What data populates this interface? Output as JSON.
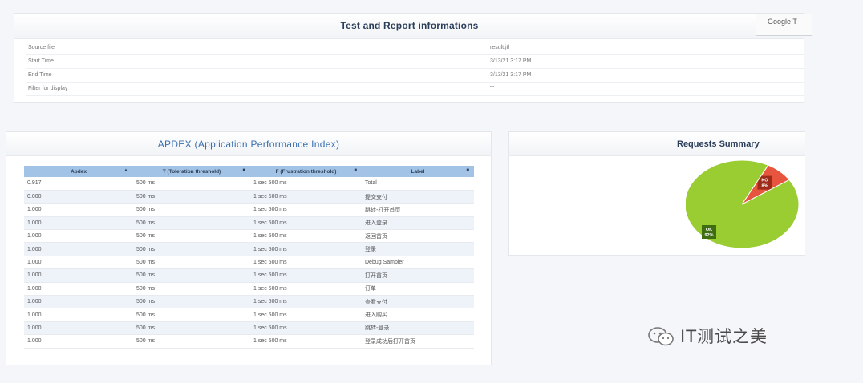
{
  "info": {
    "title": "Test and Report informations",
    "google_button": "Google T",
    "rows": [
      {
        "key": "Source file",
        "value": "result.jtl"
      },
      {
        "key": "Start Time",
        "value": "3/13/21 3:17 PM"
      },
      {
        "key": "End Time",
        "value": "3/13/21 3:17 PM"
      },
      {
        "key": "Filter for display",
        "value": "\"\""
      }
    ]
  },
  "apdex": {
    "title": "APDEX (Application Performance Index)",
    "headers": [
      "Apdex",
      "T (Toleration threshold)",
      "F (Frustration threshold)",
      "Label"
    ],
    "rows": [
      [
        "0.917",
        "500 ms",
        "1 sec 500 ms",
        "Total"
      ],
      [
        "0.000",
        "500 ms",
        "1 sec 500 ms",
        "提交支付"
      ],
      [
        "1.000",
        "500 ms",
        "1 sec 500 ms",
        "跳转-打开首页"
      ],
      [
        "1.000",
        "500 ms",
        "1 sec 500 ms",
        "进入登录"
      ],
      [
        "1.000",
        "500 ms",
        "1 sec 500 ms",
        "返回首页"
      ],
      [
        "1.000",
        "500 ms",
        "1 sec 500 ms",
        "登录"
      ],
      [
        "1.000",
        "500 ms",
        "1 sec 500 ms",
        "Debug Sampler"
      ],
      [
        "1.000",
        "500 ms",
        "1 sec 500 ms",
        "打开首页"
      ],
      [
        "1.000",
        "500 ms",
        "1 sec 500 ms",
        "订单"
      ],
      [
        "1.000",
        "500 ms",
        "1 sec 500 ms",
        "查看支付"
      ],
      [
        "1.000",
        "500 ms",
        "1 sec 500 ms",
        "进入购买"
      ],
      [
        "1.000",
        "500 ms",
        "1 sec 500 ms",
        "跳转-登录"
      ],
      [
        "1.000",
        "500 ms",
        "1 sec 500 ms",
        "登录成功后打开首页"
      ]
    ]
  },
  "summary": {
    "title": "Requests Summary",
    "chart_data": {
      "type": "pie",
      "slices": [
        {
          "name": "KO",
          "percent": 8,
          "label": "KO\n8%",
          "color": "#e8553e"
        },
        {
          "name": "OK",
          "percent": 92,
          "label": "OK\n92%",
          "color": "#9acd32"
        }
      ]
    }
  },
  "watermark": {
    "text": "IT测试之美"
  }
}
